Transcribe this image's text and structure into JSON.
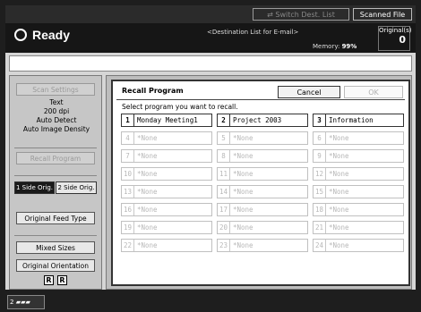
{
  "topbar": {
    "switch_dest_label": "Switch Dest. List",
    "scanned_file_status_label": "Scanned File Status"
  },
  "status": {
    "ready_label": "Ready",
    "destination_label": "<Destination List for E-mail>",
    "memory_label": "Memory:",
    "memory_value": "99%",
    "originals_label": "Original(s)",
    "originals_count": "0"
  },
  "left_panel": {
    "scan_settings_label": "Scan Settings",
    "scan_type": "Text",
    "resolution": "200 dpi",
    "density_mode": "Auto Detect",
    "density": "Auto Image Density",
    "recall_program_label": "Recall Program",
    "one_side_label": "1 Side Orig.",
    "two_side_label": "2 Side Orig.",
    "feed_type_label": "Original Feed Type",
    "mixed_sizes_label": "Mixed Sizes",
    "orientation_label": "Original Orientation",
    "orientation_icon_a": "R",
    "orientation_icon_b": "R"
  },
  "dialog": {
    "title": "Recall Program",
    "cancel_label": "Cancel",
    "ok_label": "OK",
    "instruction": "Select program you want to recall.",
    "programs": [
      {
        "num": "1",
        "name": "Monday Meeting1",
        "empty": false
      },
      {
        "num": "2",
        "name": "Project 2003",
        "empty": false
      },
      {
        "num": "3",
        "name": "Information",
        "empty": false
      },
      {
        "num": "4",
        "name": "*None",
        "empty": true
      },
      {
        "num": "5",
        "name": "*None",
        "empty": true
      },
      {
        "num": "6",
        "name": "*None",
        "empty": true
      },
      {
        "num": "7",
        "name": "*None",
        "empty": true
      },
      {
        "num": "8",
        "name": "*None",
        "empty": true
      },
      {
        "num": "9",
        "name": "*None",
        "empty": true
      },
      {
        "num": "10",
        "name": "*None",
        "empty": true
      },
      {
        "num": "11",
        "name": "*None",
        "empty": true
      },
      {
        "num": "12",
        "name": "*None",
        "empty": true
      },
      {
        "num": "13",
        "name": "*None",
        "empty": true
      },
      {
        "num": "14",
        "name": "*None",
        "empty": true
      },
      {
        "num": "15",
        "name": "*None",
        "empty": true
      },
      {
        "num": "16",
        "name": "*None",
        "empty": true
      },
      {
        "num": "17",
        "name": "*None",
        "empty": true
      },
      {
        "num": "18",
        "name": "*None",
        "empty": true
      },
      {
        "num": "19",
        "name": "*None",
        "empty": true
      },
      {
        "num": "20",
        "name": "*None",
        "empty": true
      },
      {
        "num": "21",
        "name": "*None",
        "empty": true
      },
      {
        "num": "22",
        "name": "*None",
        "empty": true
      },
      {
        "num": "23",
        "name": "*None",
        "empty": true
      },
      {
        "num": "24",
        "name": "*None",
        "empty": true
      }
    ]
  },
  "bottombar": {
    "tray_label": "2"
  },
  "colors": {
    "screen_bg": "#d6d6d6",
    "status_bg": "#161616",
    "dialog_bg": "#ffffff"
  }
}
